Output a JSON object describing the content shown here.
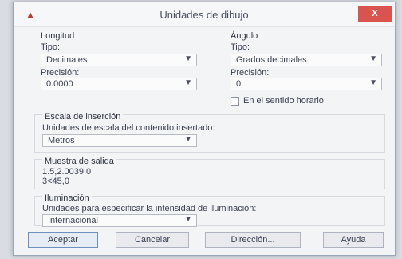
{
  "window": {
    "title": "Unidades de dibujo",
    "close_label": "X"
  },
  "length": {
    "heading": "Longitud",
    "type_label": "Tipo:",
    "type_value": "Decimales",
    "precision_label": "Precisión:",
    "precision_value": "0.0000"
  },
  "angle": {
    "heading": "Ángulo",
    "type_label": "Tipo:",
    "type_value": "Grados decimales",
    "precision_label": "Precisión:",
    "precision_value": "0",
    "clockwise_label": "En el sentido horario",
    "clockwise_checked": false
  },
  "insertion": {
    "heading": "Escala de inserción",
    "desc": "Unidades de escala del contenido insertado:",
    "value": "Metros"
  },
  "sample": {
    "heading": "Muestra de salida",
    "lines": [
      "1.5,2.0039,0",
      "3<45,0"
    ]
  },
  "lighting": {
    "heading": "Iluminación",
    "desc": "Unidades para especificar la intensidad de iluminación:",
    "value": "Internacional"
  },
  "buttons": {
    "ok": "Aceptar",
    "cancel": "Cancelar",
    "direction": "Dirección...",
    "help": "Ayuda"
  },
  "colors": {
    "close_bg": "#d9534f",
    "primary_border": "#6c8fc4"
  }
}
